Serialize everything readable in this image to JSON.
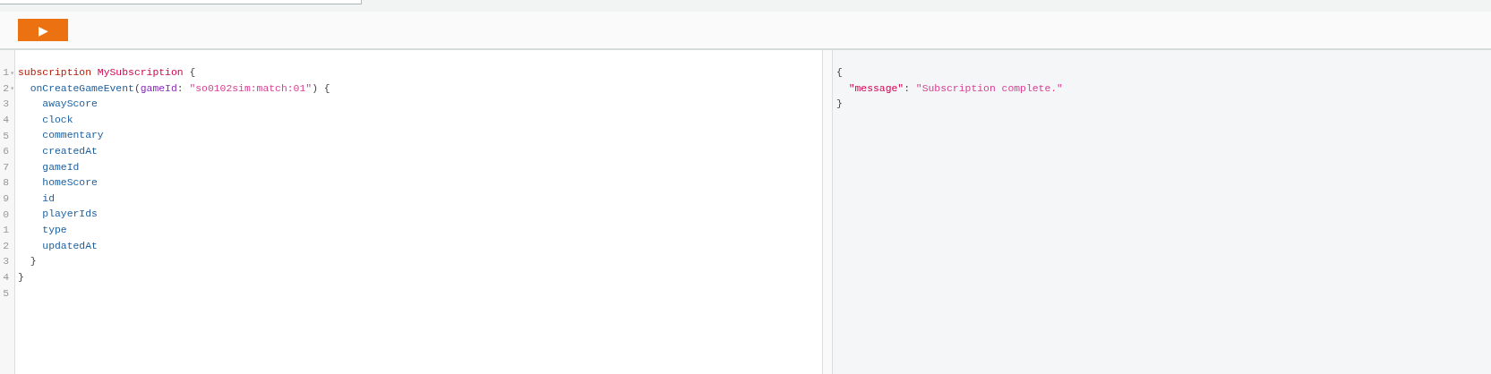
{
  "toolbar": {
    "run_button": {
      "label": "▶"
    }
  },
  "editor": {
    "lines": [
      {
        "number": "1",
        "fold": "▾",
        "tokens": [
          {
            "kind": "keyword",
            "text": "subscription"
          },
          {
            "kind": "def",
            "text": " MySubscription"
          },
          {
            "kind": "punct",
            "text": " {"
          }
        ],
        "children": [
          {
            "number": "2",
            "fold": "▾",
            "tokens": [
              {
                "kind": "field",
                "text": "onCreateGameEvent"
              },
              {
                "kind": "punct",
                "text": "("
              },
              {
                "kind": "arg",
                "text": "gameId"
              },
              {
                "kind": "punct",
                "text": ": "
              },
              {
                "kind": "string",
                "text": "\"so0102sim:match:01\""
              },
              {
                "kind": "punct",
                "text": ") {"
              }
            ],
            "children": [
              {
                "number": "3",
                "tokens": [
                  {
                    "kind": "field",
                    "text": "awayScore"
                  }
                ]
              },
              {
                "number": "4",
                "tokens": [
                  {
                    "kind": "field",
                    "text": "clock"
                  }
                ]
              },
              {
                "number": "5",
                "tokens": [
                  {
                    "kind": "field",
                    "text": "commentary"
                  }
                ]
              },
              {
                "number": "6",
                "tokens": [
                  {
                    "kind": "field",
                    "text": "createdAt"
                  }
                ]
              },
              {
                "number": "7",
                "tokens": [
                  {
                    "kind": "field",
                    "text": "gameId"
                  }
                ]
              },
              {
                "number": "8",
                "tokens": [
                  {
                    "kind": "field",
                    "text": "homeScore"
                  }
                ]
              },
              {
                "number": "9",
                "tokens": [
                  {
                    "kind": "field",
                    "text": "id"
                  }
                ]
              },
              {
                "number": "0",
                "tokens": [
                  {
                    "kind": "field",
                    "text": "playerIds"
                  }
                ]
              },
              {
                "number": "1",
                "tokens": [
                  {
                    "kind": "field",
                    "text": "type"
                  }
                ]
              },
              {
                "number": "2",
                "tokens": [
                  {
                    "kind": "field",
                    "text": "updatedAt"
                  }
                ]
              }
            ]
          },
          {
            "number": "3",
            "tokens": [
              {
                "kind": "punct",
                "text": "}"
              }
            ]
          }
        ]
      },
      {
        "number": "4",
        "tokens": [
          {
            "kind": "punct",
            "text": "}"
          }
        ]
      },
      {
        "number": "5"
      }
    ]
  },
  "result": {
    "lines": [
      {
        "tokens": [
          {
            "kind": "punct",
            "text": "{"
          }
        ],
        "children": [
          {
            "tokens": [
              {
                "kind": "key",
                "text": "\"message\""
              },
              {
                "kind": "punct",
                "text": ": "
              },
              {
                "kind": "string",
                "text": "\"Subscription complete.\""
              }
            ]
          }
        ]
      },
      {
        "tokens": [
          {
            "kind": "punct",
            "text": "}"
          }
        ]
      }
    ]
  }
}
